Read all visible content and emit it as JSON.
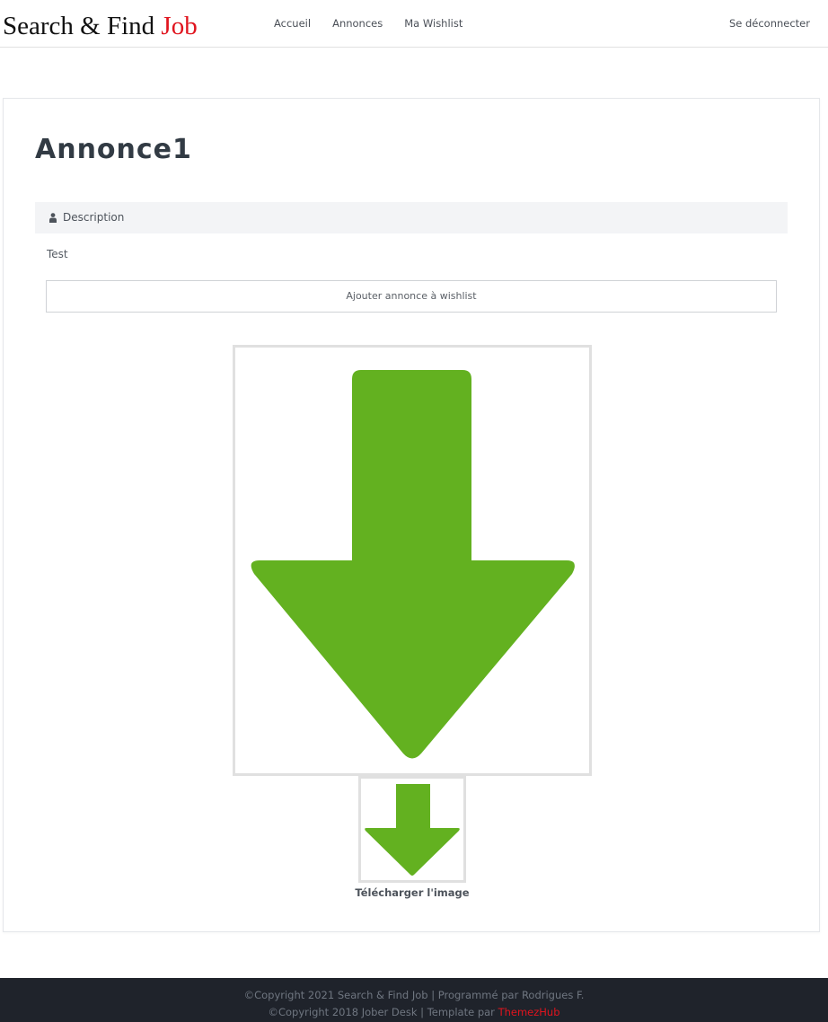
{
  "nav": {
    "brand_main": "Search & Find ",
    "brand_accent": "Job",
    "links": [
      "Accueil",
      "Annonces",
      "Ma Wishlist"
    ],
    "logout": "Se déconnecter"
  },
  "annonce": {
    "title": "Annonce1",
    "section_label": "Description",
    "section_icon": "user-icon",
    "description": "Test",
    "wishlist_button": "Ajouter annonce à wishlist",
    "download_label": "Télécharger l'image",
    "image_icon": "down-arrow-icon"
  },
  "footer": {
    "line1": "©Copyright 2021 Search & Find Job | Programmé par Rodrigues F.",
    "line2_prefix": "©Copyright 2018 Jober Desk | Template par ",
    "line2_link": "ThemezHub"
  },
  "colors": {
    "accent": "#e0141e",
    "arrow_green": "#63b120",
    "footer_bg": "#1f232b",
    "section_bg": "#f3f4f6"
  }
}
